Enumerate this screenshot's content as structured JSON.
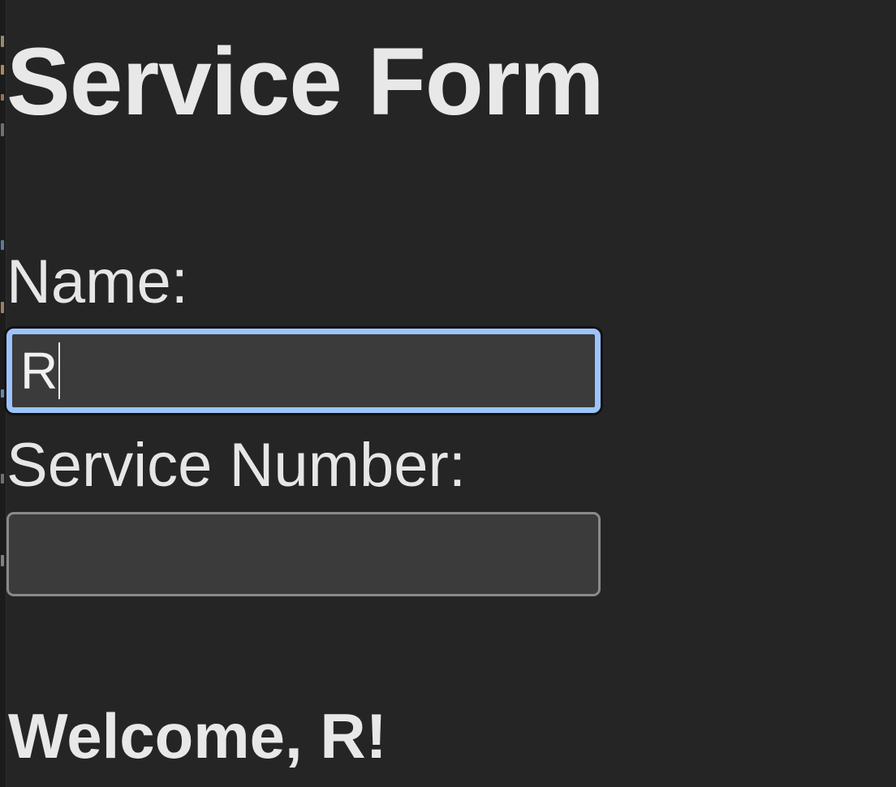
{
  "form": {
    "title": "Service Form",
    "name_label": "Name:",
    "name_value": "R",
    "service_number_label": "Service Number:",
    "service_number_value": ""
  },
  "greeting": {
    "text": "Welcome, R!"
  },
  "colors": {
    "background": "#252525",
    "text": "#e6e6e6",
    "input_background": "#3b3b3b",
    "focus_ring": "#9dc3fb",
    "input_border": "#8a8a8a"
  }
}
